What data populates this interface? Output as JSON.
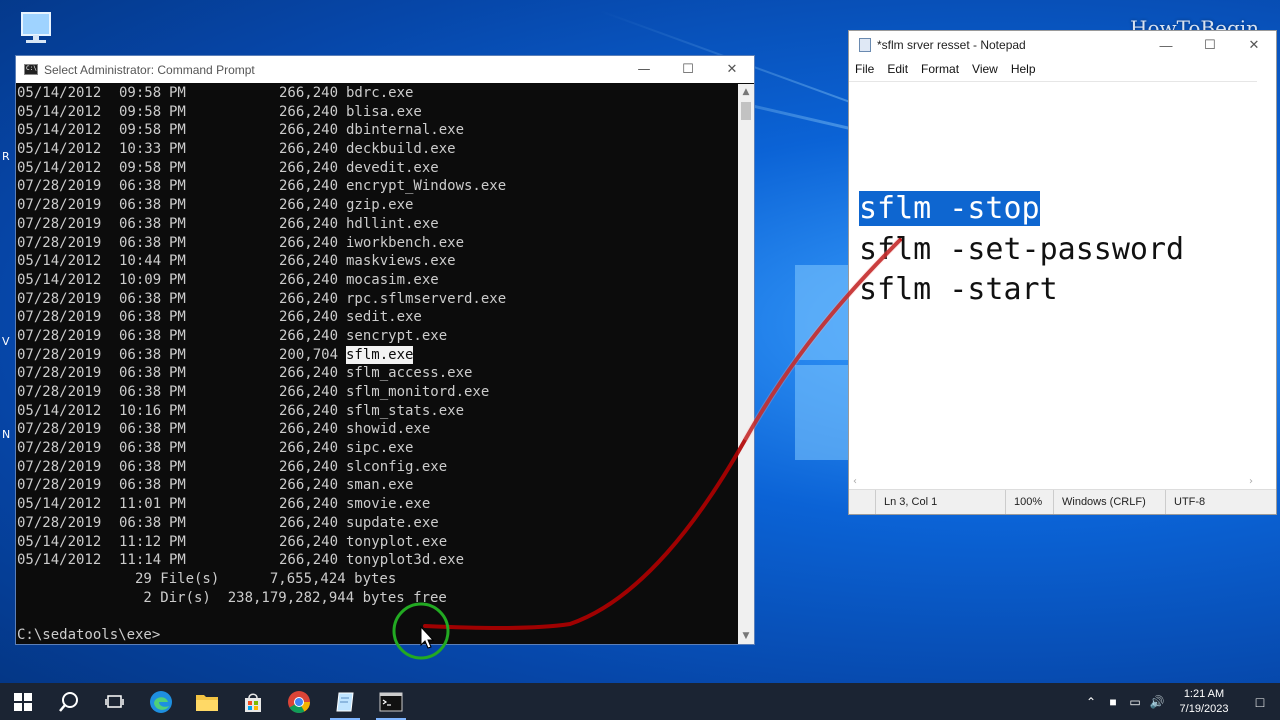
{
  "watermark": "HowToBegin",
  "cmd": {
    "title": "Select Administrator: Command Prompt",
    "rows": [
      {
        "date": "05/14/2012",
        "time": "09:58",
        "ampm": "PM",
        "size": "266,240",
        "name": "bdrc.exe"
      },
      {
        "date": "05/14/2012",
        "time": "09:58",
        "ampm": "PM",
        "size": "266,240",
        "name": "blisa.exe"
      },
      {
        "date": "05/14/2012",
        "time": "09:58",
        "ampm": "PM",
        "size": "266,240",
        "name": "dbinternal.exe"
      },
      {
        "date": "05/14/2012",
        "time": "10:33",
        "ampm": "PM",
        "size": "266,240",
        "name": "deckbuild.exe"
      },
      {
        "date": "05/14/2012",
        "time": "09:58",
        "ampm": "PM",
        "size": "266,240",
        "name": "devedit.exe"
      },
      {
        "date": "07/28/2019",
        "time": "06:38",
        "ampm": "PM",
        "size": "266,240",
        "name": "encrypt_Windows.exe"
      },
      {
        "date": "07/28/2019",
        "time": "06:38",
        "ampm": "PM",
        "size": "266,240",
        "name": "gzip.exe"
      },
      {
        "date": "07/28/2019",
        "time": "06:38",
        "ampm": "PM",
        "size": "266,240",
        "name": "hdllint.exe"
      },
      {
        "date": "07/28/2019",
        "time": "06:38",
        "ampm": "PM",
        "size": "266,240",
        "name": "iworkbench.exe"
      },
      {
        "date": "05/14/2012",
        "time": "10:44",
        "ampm": "PM",
        "size": "266,240",
        "name": "maskviews.exe"
      },
      {
        "date": "05/14/2012",
        "time": "10:09",
        "ampm": "PM",
        "size": "266,240",
        "name": "mocasim.exe"
      },
      {
        "date": "07/28/2019",
        "time": "06:38",
        "ampm": "PM",
        "size": "266,240",
        "name": "rpc.sflmserverd.exe"
      },
      {
        "date": "07/28/2019",
        "time": "06:38",
        "ampm": "PM",
        "size": "266,240",
        "name": "sedit.exe"
      },
      {
        "date": "07/28/2019",
        "time": "06:38",
        "ampm": "PM",
        "size": "266,240",
        "name": "sencrypt.exe"
      },
      {
        "date": "07/28/2019",
        "time": "06:38",
        "ampm": "PM",
        "size": "200,704",
        "name": "sflm.exe",
        "highlight": true
      },
      {
        "date": "07/28/2019",
        "time": "06:38",
        "ampm": "PM",
        "size": "266,240",
        "name": "sflm_access.exe"
      },
      {
        "date": "07/28/2019",
        "time": "06:38",
        "ampm": "PM",
        "size": "266,240",
        "name": "sflm_monitord.exe"
      },
      {
        "date": "05/14/2012",
        "time": "10:16",
        "ampm": "PM",
        "size": "266,240",
        "name": "sflm_stats.exe"
      },
      {
        "date": "07/28/2019",
        "time": "06:38",
        "ampm": "PM",
        "size": "266,240",
        "name": "showid.exe"
      },
      {
        "date": "07/28/2019",
        "time": "06:38",
        "ampm": "PM",
        "size": "266,240",
        "name": "sipc.exe"
      },
      {
        "date": "07/28/2019",
        "time": "06:38",
        "ampm": "PM",
        "size": "266,240",
        "name": "slconfig.exe"
      },
      {
        "date": "07/28/2019",
        "time": "06:38",
        "ampm": "PM",
        "size": "266,240",
        "name": "sman.exe"
      },
      {
        "date": "05/14/2012",
        "time": "11:01",
        "ampm": "PM",
        "size": "266,240",
        "name": "smovie.exe"
      },
      {
        "date": "07/28/2019",
        "time": "06:38",
        "ampm": "PM",
        "size": "266,240",
        "name": "supdate.exe"
      },
      {
        "date": "05/14/2012",
        "time": "11:12",
        "ampm": "PM",
        "size": "266,240",
        "name": "tonyplot.exe"
      },
      {
        "date": "05/14/2012",
        "time": "11:14",
        "ampm": "PM",
        "size": "266,240",
        "name": "tonyplot3d.exe"
      }
    ],
    "summary_files": "              29 File(s)      7,655,424 bytes",
    "summary_dirs": "               2 Dir(s)  238,179,282,944 bytes free",
    "prompt": "C:\\sedatools\\exe>"
  },
  "notepad": {
    "title": "*sflm srver resset - Notepad",
    "menu": [
      "File",
      "Edit",
      "Format",
      "View",
      "Help"
    ],
    "lines": [
      "sflm -stop",
      "sflm -set-password",
      "sflm -start"
    ],
    "status": {
      "position": "Ln 3, Col 1",
      "zoom": "100%",
      "eol": "Windows (CRLF)",
      "encoding": "UTF-8"
    }
  },
  "taskbar": {
    "clock_time": "1:21 AM",
    "clock_date": "7/19/2023"
  },
  "colors": {
    "selection": "#0e66d0",
    "annotation": "#b00000",
    "cursor_ring": "#22aa22"
  }
}
